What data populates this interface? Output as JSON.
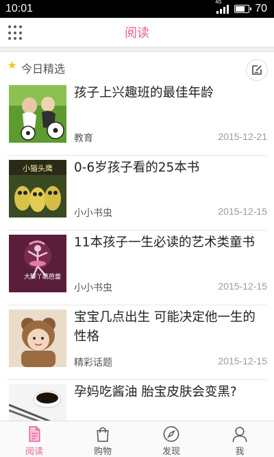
{
  "status_bar": {
    "time": "10:01",
    "network": "4G",
    "battery": "70"
  },
  "header": {
    "title": "阅读"
  },
  "section": {
    "label": "今日精选"
  },
  "articles": [
    {
      "title": "孩子上兴趣班的最佳年龄",
      "source": "教育",
      "date": "2015-12-21"
    },
    {
      "title": "0-6岁孩子看的25本书",
      "source": "小小书虫",
      "date": "2015-12-15",
      "thumb_text": "小猫头鹰"
    },
    {
      "title": "11本孩子一生必读的艺术类童书",
      "source": "小小书虫",
      "date": "2015-12-15",
      "thumb_text": "大脚丫跳芭蕾"
    },
    {
      "title": "宝宝几点出生 可能决定他一生的性格",
      "source": "精彩话题",
      "date": "2015-12-15"
    },
    {
      "title": "孕妈吃酱油 胎宝皮肤会变黑?",
      "source": "",
      "date": ""
    }
  ],
  "tabs": [
    {
      "label": "阅读",
      "icon": "book-icon",
      "active": true
    },
    {
      "label": "购物",
      "icon": "bag-icon",
      "active": false
    },
    {
      "label": "发现",
      "icon": "compass-icon",
      "active": false
    },
    {
      "label": "我",
      "icon": "person-icon",
      "active": false
    }
  ],
  "colors": {
    "accent": "#e8609a",
    "star": "#f4c20d"
  }
}
